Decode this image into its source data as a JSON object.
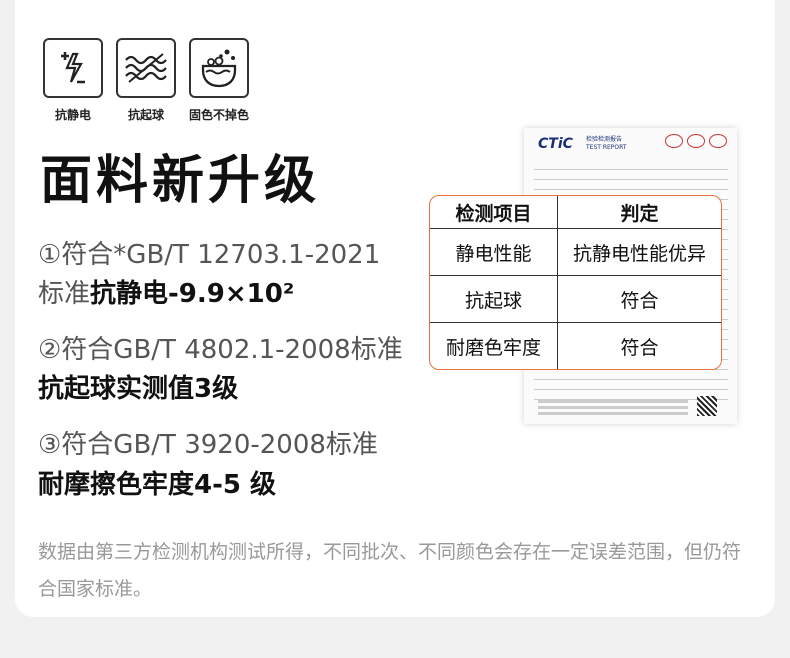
{
  "icons": [
    {
      "name": "antistatic-icon",
      "label": "抗静电"
    },
    {
      "name": "anti-pilling-icon",
      "label": "抗起球"
    },
    {
      "name": "colorfast-icon",
      "label": "固色不掉色"
    }
  ],
  "title": "面料新升级",
  "spec1": {
    "line1": "①符合*GB/T 12703.1-2021",
    "line2_prefix": "标准",
    "line2_bold": "抗静电-9.9×10²"
  },
  "spec2": {
    "line1": "②符合GB/T 4802.1-2008标准",
    "line2_bold": "抗起球实测值3级"
  },
  "spec3": {
    "line1": "③符合GB/T 3920-2008标准",
    "line2_bold": "耐摩擦色牢度4-5 级"
  },
  "note": "数据由第三方检测机构测试所得，不同批次、不同颜色会存在一定误差范围，但仍符合国家标准。",
  "report": {
    "brand": "CTiC",
    "title_cn": "检验检测报告",
    "title_en": "TEST REPORT"
  },
  "result_table": {
    "headers": [
      "检测项目",
      "判定"
    ],
    "rows": [
      [
        "静电性能",
        "抗静电性能优异"
      ],
      [
        "抗起球",
        "符合"
      ],
      [
        "耐磨色牢度",
        "符合"
      ]
    ]
  }
}
